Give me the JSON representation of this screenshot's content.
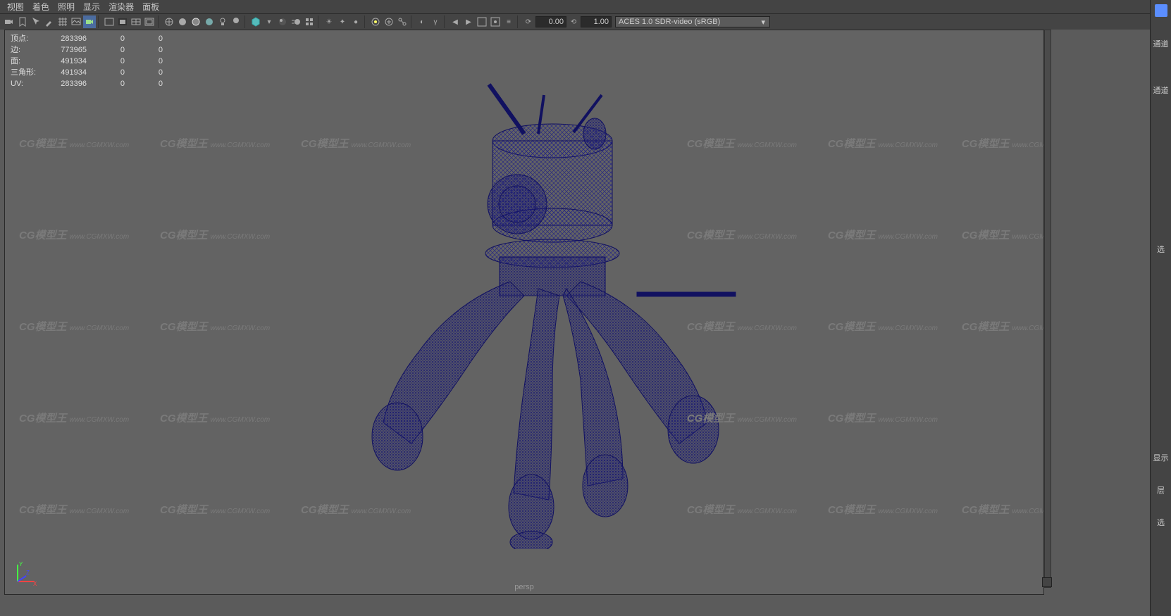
{
  "menu": [
    "视图",
    "着色",
    "照明",
    "显示",
    "渲染器",
    "面板"
  ],
  "toolbar": {
    "numA": "0.00",
    "numB": "1.00",
    "colorspace": "ACES 1.0 SDR-video (sRGB)"
  },
  "stats": {
    "rows": [
      {
        "label": "顶点:",
        "value": "283396",
        "cols": [
          "0",
          "0"
        ]
      },
      {
        "label": "边:",
        "value": "773965",
        "cols": [
          "0",
          "0"
        ]
      },
      {
        "label": "面:",
        "value": "491934",
        "cols": [
          "0",
          "0"
        ]
      },
      {
        "label": "三角形:",
        "value": "491934",
        "cols": [
          "0",
          "0"
        ]
      },
      {
        "label": "UV:",
        "value": "283396",
        "cols": [
          "0",
          "0"
        ]
      }
    ]
  },
  "camera": "persp",
  "rightPanel": {
    "top": "通道",
    "mid": "通道",
    "sel": "选",
    "show": "显示",
    "layer": "层",
    "ext": "选"
  },
  "watermark": {
    "main": "CG模型王",
    "sub": "www.CGMXW.com"
  },
  "axis": {
    "x": "X",
    "y": "Y",
    "z": "Z"
  }
}
